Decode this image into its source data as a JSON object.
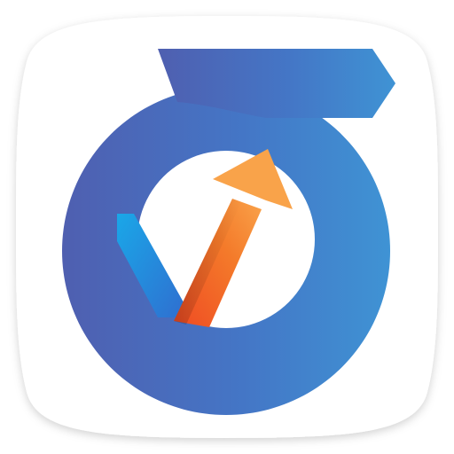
{
  "app": {
    "icon_name": "growth-check-arrow-icon"
  },
  "colors": {
    "tile_background": "#ffffff",
    "tile_shadow": "#d9d9d9",
    "ring_dark": "#4f5fb0",
    "ring_mid": "#4476c6",
    "ring_light": "#3f93d4",
    "check_cyan": "#1aa7e8",
    "check_blue": "#2f6fd0",
    "arrow_orange": "#f47a2a",
    "arrow_red": "#ef4a23",
    "arrow_light": "#f9a34a"
  }
}
